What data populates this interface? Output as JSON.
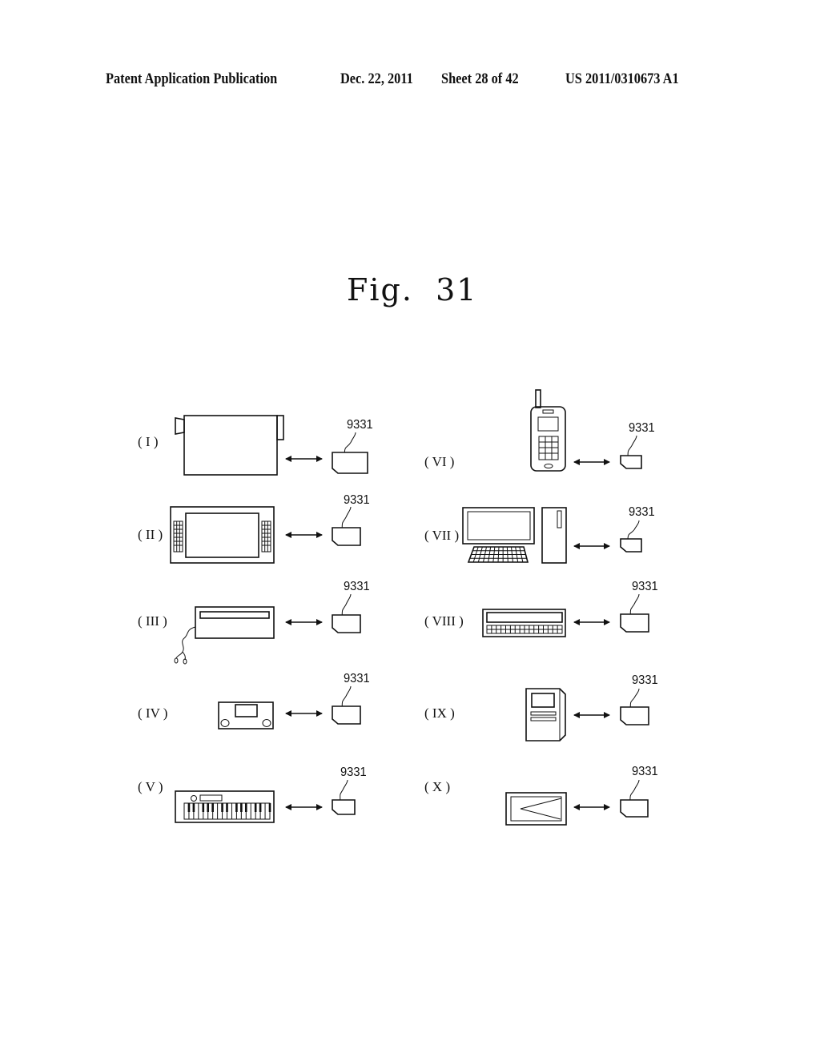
{
  "header": {
    "publication": "Patent Application Publication",
    "date": "Dec. 22, 2011",
    "sheet": "Sheet 28 of 42",
    "number": "US 2011/0310673 A1"
  },
  "figure": {
    "title": "Fig.  31",
    "items": [
      {
        "label": "( I )",
        "device": "camcorder",
        "ref": "9331",
        "card": "memory-card"
      },
      {
        "label": "( II )",
        "device": "portable-game-console",
        "ref": "9331",
        "card": "memory-card"
      },
      {
        "label": "( III )",
        "device": "mp3-player-with-earphones",
        "ref": "9331",
        "card": "memory-card"
      },
      {
        "label": "( IV )",
        "device": "audio-player",
        "ref": "9331",
        "card": "memory-card"
      },
      {
        "label": "( V )",
        "device": "electronic-keyboard",
        "ref": "9331",
        "card": "memory-card"
      },
      {
        "label": "( VI )",
        "device": "mobile-phone",
        "ref": "9331",
        "card": "memory-card"
      },
      {
        "label": "( VII )",
        "device": "desktop-computer",
        "ref": "9331",
        "card": "memory-card"
      },
      {
        "label": "( VIII )",
        "device": "pda-keyboard-device",
        "ref": "9331",
        "card": "memory-card"
      },
      {
        "label": "( IX )",
        "device": "terminal",
        "ref": "9331",
        "card": "memory-card"
      },
      {
        "label": "( X )",
        "device": "digital-photo-frame",
        "ref": "9331",
        "card": "memory-card"
      }
    ],
    "connector": "bidirectional-arrow"
  }
}
